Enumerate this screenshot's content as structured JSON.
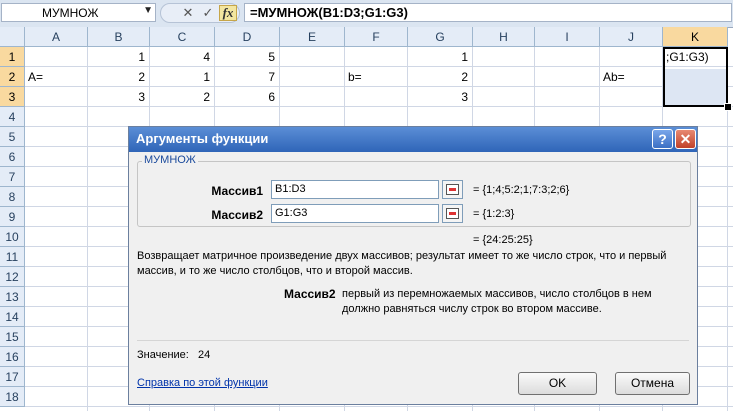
{
  "formula_bar": {
    "name_box": "МУМНОЖ",
    "cancel_symbol": "✕",
    "enter_symbol": "✓",
    "fx_label": "fx",
    "formula": "=МУМНОЖ(B1:D3;G1:G3)"
  },
  "sheet": {
    "columns": [
      "A",
      "B",
      "C",
      "D",
      "E",
      "F",
      "G",
      "H",
      "I",
      "J",
      "K"
    ],
    "rows": [
      "1",
      "2",
      "3",
      "4",
      "5",
      "6",
      "7",
      "8",
      "9",
      "10",
      "11",
      "12",
      "13",
      "14",
      "15",
      "16",
      "17",
      "18"
    ],
    "cells": {
      "B1": "1",
      "C1": "4",
      "D1": "5",
      "G1": "1",
      "A2": "A=",
      "B2": "2",
      "C2": "1",
      "D2": "7",
      "F2": "b=",
      "G2": "2",
      "J2": "Ab=",
      "B3": "3",
      "C3": "2",
      "D3": "6",
      "G3": "3",
      "K1": ";G1:G3)"
    },
    "selected_column": "K",
    "selected_rows": [
      "1",
      "2",
      "3"
    ]
  },
  "dialog": {
    "title": "Аргументы функции",
    "help_symbol": "?",
    "close_symbol": "✕",
    "function_name": "МУМНОЖ",
    "args": [
      {
        "label": "Массив1",
        "value": "B1:D3",
        "result": "= {1;4;5:2;1;7:3;2;6}"
      },
      {
        "label": "Массив2",
        "value": "G1:G3",
        "result": "= {1:2:3}"
      }
    ],
    "total_result": "= {24:25:25}",
    "description": "Возвращает матричное произведение двух массивов; результат имеет то же число строк, что и первый массив, и то же число столбцов, что и второй массив.",
    "arg_help_name": "Массив2",
    "arg_help_text": "первый из перемножаемых массивов, число столбцов в нем должно равняться числу строк во втором массиве.",
    "value_label": "Значение:",
    "value": "24",
    "help_link": "Справка по этой функции",
    "ok_label": "OK",
    "cancel_label": "Отмена"
  }
}
